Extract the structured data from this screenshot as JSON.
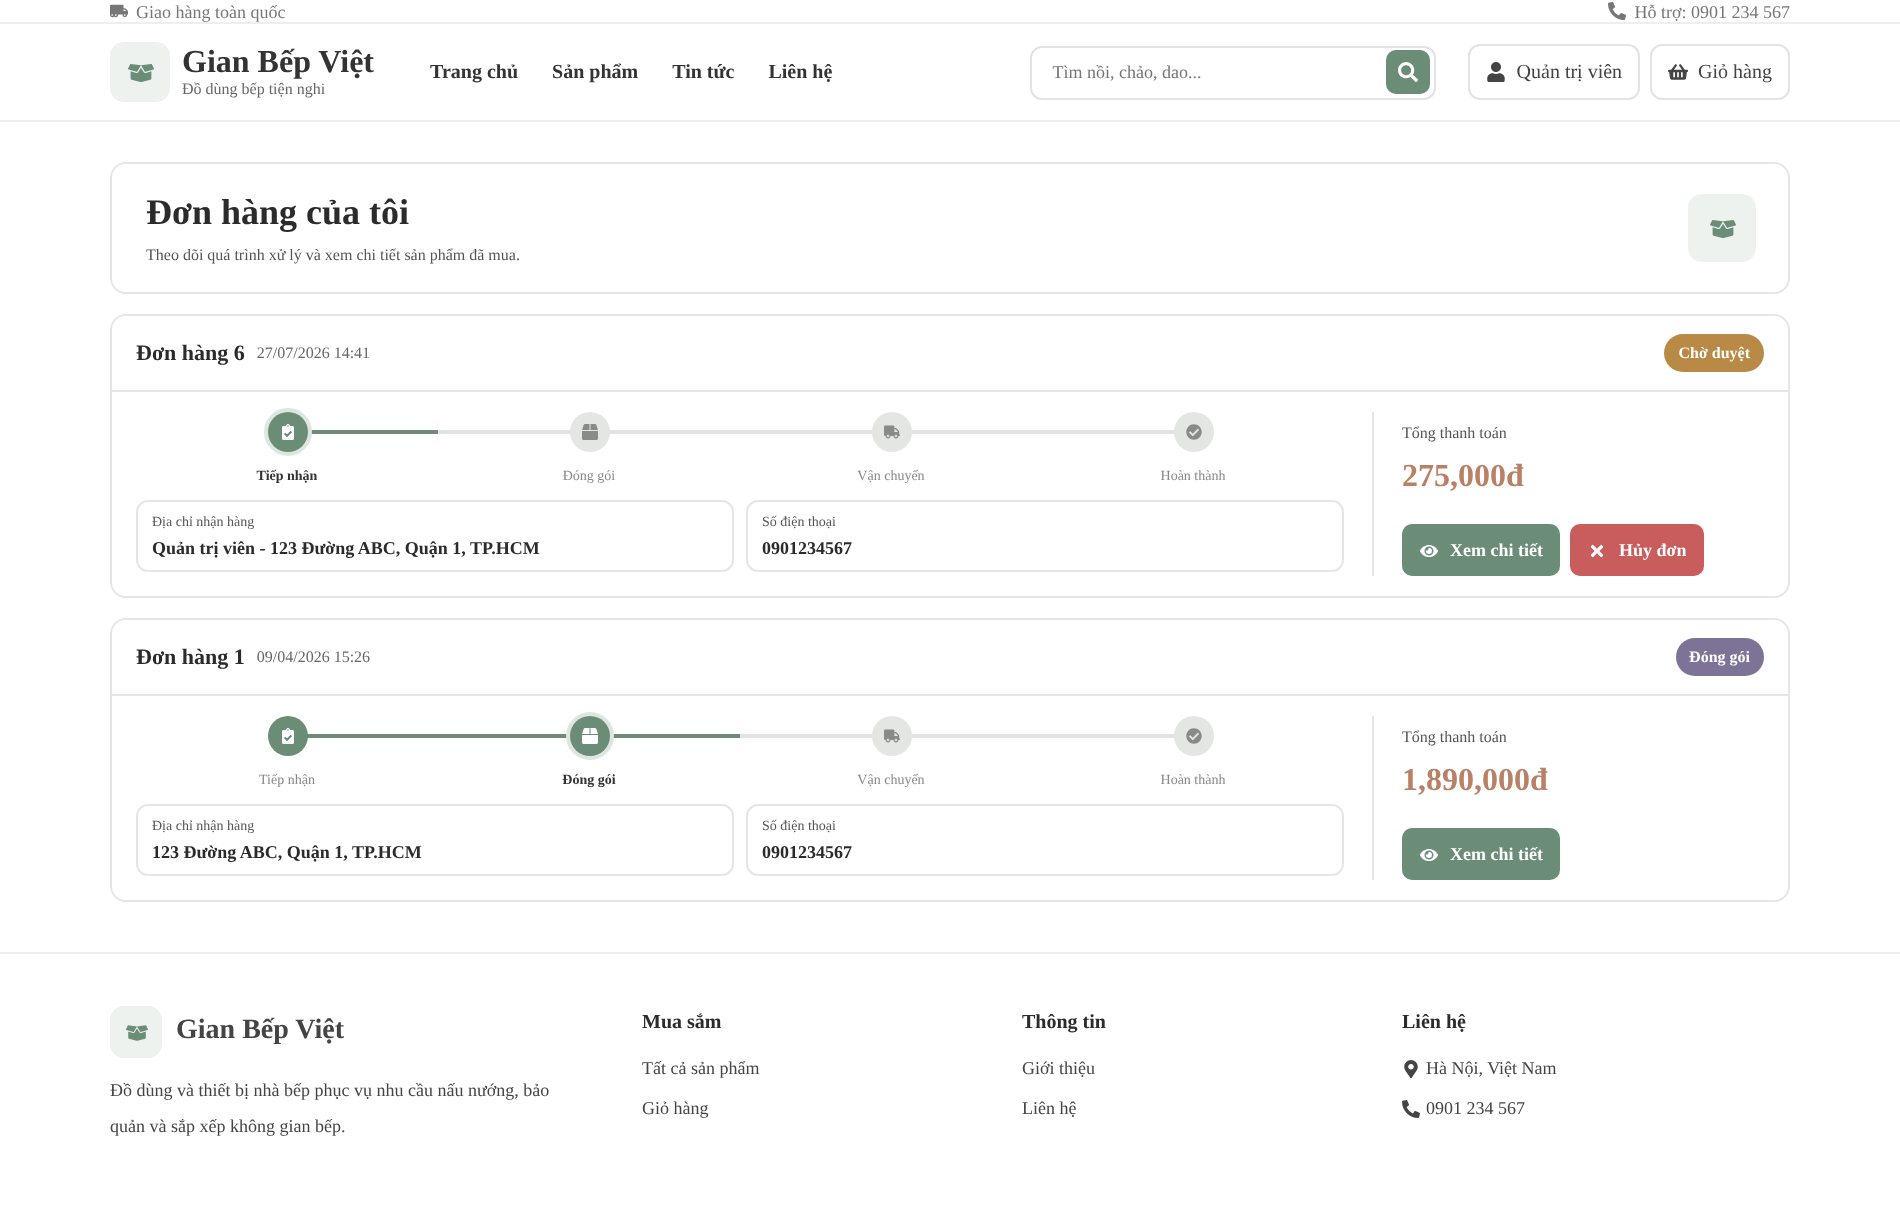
{
  "top_bar": {
    "left": "Giao hàng toàn quốc",
    "right": "Hỗ trợ: 0901 234 567"
  },
  "header": {
    "brand": "Gian Bếp Việt",
    "tagline": "Đồ dùng bếp tiện nghi",
    "nav": [
      {
        "label": "Trang chủ"
      },
      {
        "label": "Sản phẩm"
      },
      {
        "label": "Tin tức"
      },
      {
        "label": "Liên hệ"
      }
    ],
    "search": {
      "placeholder": "Tìm nồi, chảo, dao..."
    },
    "account": "Quản trị viên",
    "cart": "Giỏ hàng"
  },
  "page": {
    "title": "Đơn hàng của tôi",
    "subtitle": "Theo dõi quá trình xử lý và xem chi tiết sản phẩm đã mua."
  },
  "orders": [
    {
      "name": "Đơn hàng 6",
      "date": "27/07/2026 14:41",
      "status": "Chờ duyệt",
      "color": "#b98a45",
      "steps": [
        {
          "label": "Tiếp nhận",
          "done": false,
          "current": true
        },
        {
          "label": "Đóng gói",
          "done": false,
          "current": false
        },
        {
          "label": "Vận chuyển",
          "done": false,
          "current": false
        },
        {
          "label": "Hoàn thành",
          "done": false,
          "current": false
        }
      ],
      "address_label": "Địa chỉ nhận hàng",
      "address": "Quản trị viên - 123 Đường ABC, Quận 1, TP.HCM",
      "phone_label": "Số điện thoại",
      "phone": "0901234567",
      "total_label": "Tổng thanh toán",
      "total": "275,000đ",
      "buttons": [
        {
          "kind": "view",
          "label": "Xem chi tiết"
        },
        {
          "kind": "cancel",
          "label": "Hủy đơn"
        }
      ]
    },
    {
      "name": "Đơn hàng 1",
      "date": "09/04/2026 15:26",
      "status": "Đóng gói",
      "color": "#7d7396",
      "steps": [
        {
          "label": "Tiếp nhận",
          "done": true,
          "current": false
        },
        {
          "label": "Đóng gói",
          "done": false,
          "current": true
        },
        {
          "label": "Vận chuyển",
          "done": false,
          "current": false
        },
        {
          "label": "Hoàn thành",
          "done": false,
          "current": false
        }
      ],
      "address_label": "Địa chỉ nhận hàng",
      "address": "123 Đường ABC, Quận 1, TP.HCM",
      "phone_label": "Số điện thoại",
      "phone": "0901234567",
      "total_label": "Tổng thanh toán",
      "total": "1,890,000đ",
      "buttons": [
        {
          "kind": "view",
          "label": "Xem chi tiết"
        }
      ]
    }
  ],
  "footer": {
    "brand": "Gian Bếp Việt",
    "description": "Đồ dùng và thiết bị nhà bếp phục vụ nhu cầu nấu nướng, bảo quản và sắp xếp không gian bếp.",
    "columns": [
      {
        "title": "Mua sắm",
        "links": [
          {
            "label": "Tất cả sản phẩm"
          },
          {
            "label": "Giỏ hàng"
          }
        ]
      },
      {
        "title": "Thông tin",
        "links": [
          {
            "label": "Giới thiệu"
          },
          {
            "label": "Liên hệ"
          }
        ]
      },
      {
        "title": "Liên hệ",
        "links": [
          {
            "label": "Hà Nội, Việt Nam",
            "kind": "location"
          },
          {
            "label": "0901 234 567",
            "kind": "phone"
          }
        ]
      }
    ]
  }
}
